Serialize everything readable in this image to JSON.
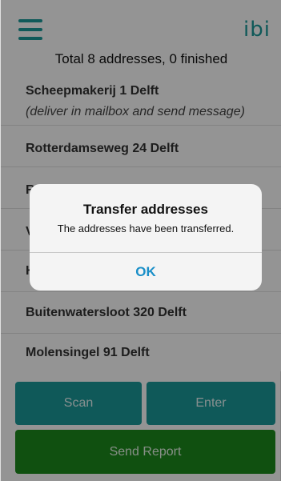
{
  "header": {
    "menu_icon": "hamburger-menu-icon",
    "logo": "ibi",
    "summary": "Total 8 addresses, 0 finished"
  },
  "addresses": [
    {
      "address": "Scheepmakerij 1 Delft",
      "note": "(deliver in mailbox and send message)"
    },
    {
      "address": "Rotterdamseweg 24 Delft"
    },
    {
      "address": "R"
    },
    {
      "address": "V"
    },
    {
      "address": "H"
    },
    {
      "address": "Buitenwatersloot 320 Delft"
    },
    {
      "address": "Molensingel 91 Delft"
    }
  ],
  "buttons": {
    "scan": "Scan",
    "enter": "Enter",
    "send_report": "Send Report"
  },
  "dialog": {
    "title": "Transfer addresses",
    "message": "The addresses have been transferred.",
    "ok": "OK"
  },
  "colors": {
    "teal": "#1a9a9a",
    "green": "#1c8a1c",
    "link_blue": "#1a8fc8"
  }
}
